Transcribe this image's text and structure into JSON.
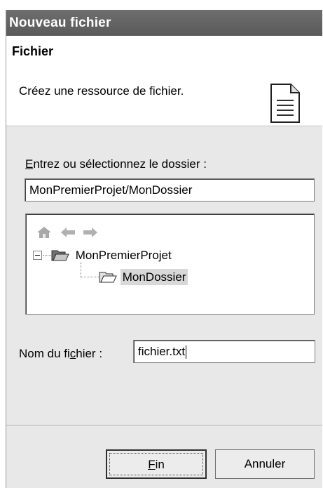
{
  "window": {
    "title": "Nouveau fichier"
  },
  "banner": {
    "title": "Fichier",
    "description": "Créez une ressource de fichier.",
    "icon": "document-icon"
  },
  "folder": {
    "label_first": "E",
    "label_rest": "ntrez ou sélectionnez le dossier :",
    "value": "MonPremierProjet/MonDossier"
  },
  "tree": {
    "toolbar": [
      "home-icon",
      "back-arrow-icon",
      "forward-arrow-icon"
    ],
    "nodes": [
      {
        "label": "MonPremierProjet",
        "expanded": true,
        "icon": "open-folder-icon"
      },
      {
        "label": "MonDossier",
        "selected": true,
        "icon": "open-folder-icon"
      }
    ]
  },
  "filename": {
    "label_before": "Nom du fi",
    "label_mnemonic": "c",
    "label_after": "hier :",
    "value": "fichier.txt"
  },
  "buttons": {
    "finish_mnemonic": "F",
    "finish_rest": "in",
    "cancel": "Annuler"
  },
  "colors": {
    "titlebar": "#626262",
    "dialog_bg": "#e8e8e8",
    "selection": "#d8d8d8"
  }
}
